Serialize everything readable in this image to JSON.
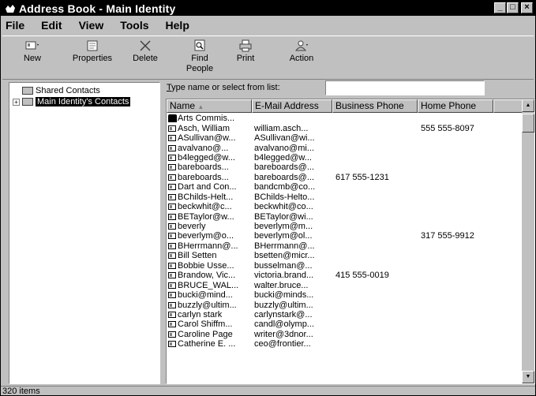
{
  "window": {
    "title": "Address Book - Main Identity"
  },
  "window_buttons": {
    "minimize": "_",
    "maximize": "□",
    "close": "×"
  },
  "menu": [
    "File",
    "Edit",
    "View",
    "Tools",
    "Help"
  ],
  "toolbar": {
    "new": "New",
    "properties": "Properties",
    "delete": "Delete",
    "find_line1": "Find",
    "find_line2": "People",
    "print": "Print",
    "action": "Action"
  },
  "tree": {
    "shared": "Shared Contacts",
    "main": "Main Identity's Contacts"
  },
  "search": {
    "label_first": "T",
    "label_rest": "ype name or select from list:",
    "value": ""
  },
  "columns": {
    "name": "Name",
    "email": "E-Mail Address",
    "business": "Business Phone",
    "home": "Home Phone"
  },
  "contacts": [
    {
      "name": "Arts Commis...",
      "email": "",
      "business": "",
      "home": "",
      "type": "group"
    },
    {
      "name": "Asch, William",
      "email": "william.asch...",
      "business": "",
      "home": "555 555-8097"
    },
    {
      "name": "ASullivan@w...",
      "email": "ASullivan@wi...",
      "business": "",
      "home": ""
    },
    {
      "name": "avalvano@...",
      "email": "avalvano@mi...",
      "business": "",
      "home": ""
    },
    {
      "name": "b4legged@w...",
      "email": "b4legged@w...",
      "business": "",
      "home": ""
    },
    {
      "name": "bareboards...",
      "email": "bareboards@...",
      "business": "",
      "home": ""
    },
    {
      "name": "bareboards...",
      "email": "bareboards@...",
      "business": "617 555-1231",
      "home": ""
    },
    {
      "name": "Dart and Con...",
      "email": "bandcmb@co...",
      "business": "",
      "home": ""
    },
    {
      "name": "BChilds-Helt...",
      "email": "BChilds-Helto...",
      "business": "",
      "home": ""
    },
    {
      "name": "beckwhit@c...",
      "email": "beckwhit@co...",
      "business": "",
      "home": ""
    },
    {
      "name": "BETaylor@w...",
      "email": "BETaylor@wi...",
      "business": "",
      "home": ""
    },
    {
      "name": "beverly",
      "email": "beverlym@m...",
      "business": "",
      "home": ""
    },
    {
      "name": "beverlym@o...",
      "email": "beverlym@ol...",
      "business": "",
      "home": "317 555-9912"
    },
    {
      "name": "BHerrmann@...",
      "email": "BHerrmann@...",
      "business": "",
      "home": ""
    },
    {
      "name": "Bill Setten",
      "email": "bsetten@micr...",
      "business": "",
      "home": ""
    },
    {
      "name": "Bobbie Usse...",
      "email": "busselman@...",
      "business": "",
      "home": ""
    },
    {
      "name": "Brandow, Vic...",
      "email": "victoria.brand...",
      "business": "415 555-0019",
      "home": ""
    },
    {
      "name": "BRUCE_WAL...",
      "email": "walter.bruce...",
      "business": "",
      "home": ""
    },
    {
      "name": "bucki@mind...",
      "email": "bucki@minds...",
      "business": "",
      "home": ""
    },
    {
      "name": "buzzly@ultim...",
      "email": "buzzly@ultim...",
      "business": "",
      "home": ""
    },
    {
      "name": "carlyn stark",
      "email": "carlynstark@...",
      "business": "",
      "home": ""
    },
    {
      "name": "Carol Shiffm...",
      "email": "candl@olymp...",
      "business": "",
      "home": ""
    },
    {
      "name": "Caroline Page",
      "email": "writer@3dnor...",
      "business": "",
      "home": ""
    },
    {
      "name": "Catherine E. ...",
      "email": "ceo@frontier...",
      "business": "",
      "home": ""
    }
  ],
  "status": {
    "count": "320 items"
  }
}
